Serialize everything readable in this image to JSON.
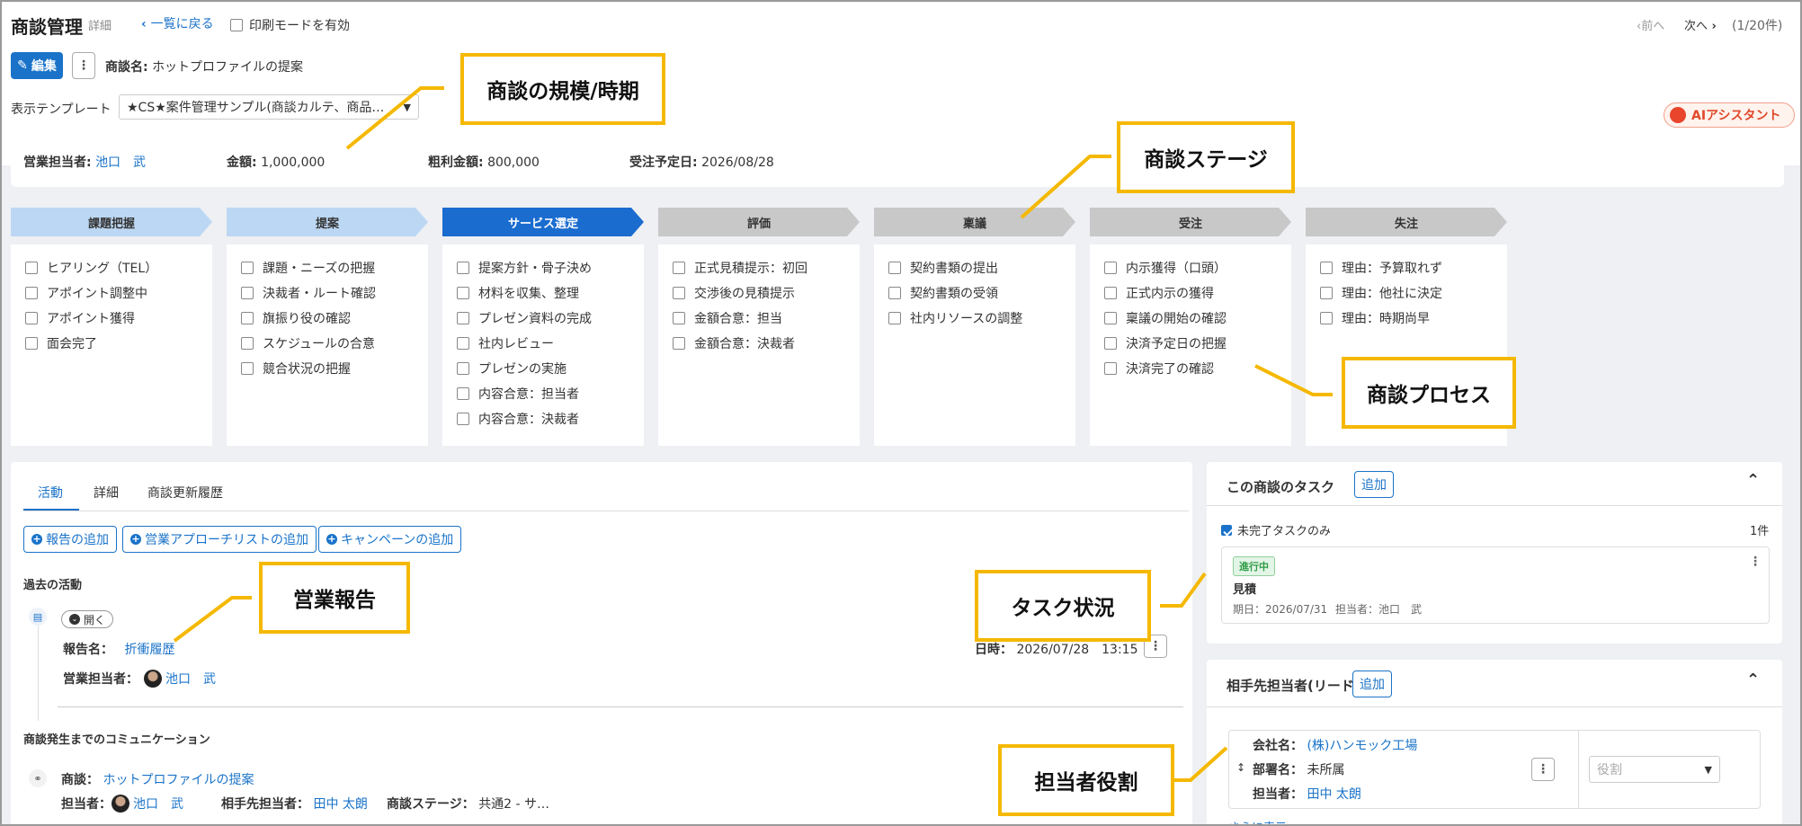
{
  "header": {
    "title": "商談管理",
    "subtitle": "詳細",
    "back_link": "一覧に戻る",
    "print_mode": "印刷モードを有効",
    "prev": "前へ",
    "next": "次へ",
    "count": "(1/20件)"
  },
  "toolbar": {
    "edit": "編集",
    "deal_name_label": "商談名:",
    "deal_name": "ホットプロファイルの提案"
  },
  "template": {
    "label": "表示テンプレート",
    "value": "★CS★案件管理サンプル(商談カルテ、商品…"
  },
  "ai_assistant": "AIアシスタント",
  "info": {
    "owner_label": "営業担当者:",
    "owner": "池口　武",
    "amount_label": "金額:",
    "amount": "1,000,000",
    "gross_label": "粗利金額:",
    "gross": "800,000",
    "date_label": "受注予定日:",
    "date": "2026/08/28"
  },
  "stages": [
    {
      "label": "課題把握",
      "state": "past",
      "items": [
        "ヒアリング（TEL）",
        "アポイント調整中",
        "アポイント獲得",
        "面会完了"
      ]
    },
    {
      "label": "提案",
      "state": "past",
      "items": [
        "課題・ニーズの把握",
        "決裁者・ルート確認",
        "旗振り役の確認",
        "スケジュールの合意",
        "競合状況の把握"
      ]
    },
    {
      "label": "サービス選定",
      "state": "current",
      "items": [
        "提案方針・骨子決め",
        "材料を収集、整理",
        "プレゼン資料の完成",
        "社内レビュー",
        "プレゼンの実施",
        "内容合意：担当者",
        "内容合意：決裁者"
      ]
    },
    {
      "label": "評価",
      "state": "future",
      "items": [
        "正式見積提示：初回",
        "交渉後の見積提示",
        "金額合意：担当",
        "金額合意：決裁者"
      ]
    },
    {
      "label": "稟議",
      "state": "future",
      "items": [
        "契約書類の提出",
        "契約書類の受領",
        "社内リソースの調整"
      ]
    },
    {
      "label": "受注",
      "state": "future",
      "items": [
        "内示獲得（口頭）",
        "正式内示の獲得",
        "稟議の開始の確認",
        "決済予定日の把握",
        "決済完了の確認"
      ]
    },
    {
      "label": "失注",
      "state": "future",
      "items": [
        "理由：予算取れず",
        "理由：他社に決定",
        "理由：時期尚早"
      ]
    }
  ],
  "colors": {
    "past": "#bcd7f3",
    "current": "#1a6ccf",
    "future": "#c8c8c8"
  },
  "activity": {
    "tabs": [
      "活動",
      "詳細",
      "商談更新履歴"
    ],
    "actions": [
      "報告の追加",
      "営業アプローチリストの追加",
      "キャンペーンの追加"
    ],
    "past_heading": "過去の活動",
    "open_label": "開く",
    "report_name_label": "報告名：",
    "report_name": "折衝履歴",
    "owner_label": "営業担当者：",
    "owner": "池口　武",
    "datetime_label": "日時：",
    "datetime": "2026/07/28　13:15",
    "comm_heading": "商談発生までのコミュニケーション",
    "deal_label": "商談：",
    "deal": "ホットプロファイルの提案",
    "person_label": "担当者：",
    "person": "池口　武",
    "contact_label": "相手先担当者：",
    "contact": "田中 太朗",
    "stage_label": "商談ステージ：",
    "stage": "共通2 - サ…"
  },
  "tasks": {
    "title": "この商談のタスク",
    "add": "追加",
    "filter": "未完了タスクのみ",
    "count": "1件",
    "badge": "進行中",
    "name": "見積",
    "due": "期日：2026/07/31",
    "assignee": "担当者：池口　武"
  },
  "contacts": {
    "title": "相手先担当者(リード)",
    "add": "追加",
    "company_label": "会社名：",
    "company": "(株)ハンモック工場",
    "dept_label": "部署名：",
    "dept": "未所属",
    "person_label": "担当者：",
    "person": "田中 太朗",
    "role_placeholder": "役割",
    "more": "さらに表示"
  },
  "callouts": {
    "scale": "商談の規模/時期",
    "stage": "商談ステージ",
    "process": "商談プロセス",
    "report": "営業報告",
    "task": "タスク状況",
    "role": "担当者役割"
  }
}
